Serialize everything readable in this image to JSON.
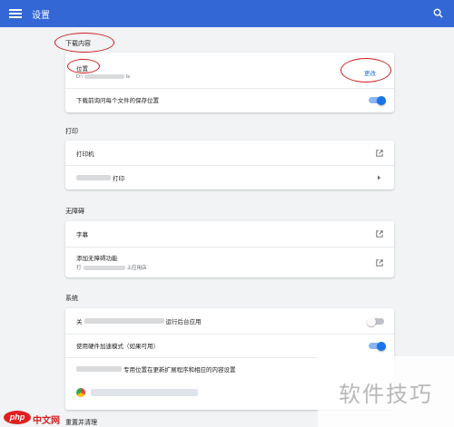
{
  "topbar": {
    "title": "设置"
  },
  "download": {
    "section_title": "下载内容",
    "location_label": "位置",
    "location_path": "D:\\",
    "location_suffix": "ls",
    "change_button": "更改",
    "ask_label": "下载前询问每个文件的保存位置",
    "ask_enabled": true
  },
  "print": {
    "section_title": "打印",
    "printers_label": "打印机",
    "cloud_print_label": "打印"
  },
  "accessibility": {
    "section_title": "无障碍",
    "captions_label": "字幕",
    "add_features_label": "添加无障碍功能",
    "add_features_sub_prefix": "打",
    "add_features_sub_suffix": "上应用店"
  },
  "system": {
    "section_title": "系统",
    "background_apps_prefix": "关",
    "background_apps_suffix": "运行后台应用",
    "background_apps_enabled": false,
    "hw_accel_label": "使用硬件加速模式（如果可用）",
    "hw_accel_enabled": true,
    "proxy_label": "专用位置在更新扩展程序和相应的内容设置"
  },
  "reset": {
    "section_title": "重置并清理"
  },
  "watermark": {
    "text": "软件技巧"
  },
  "logo": {
    "php": "php",
    "cn": "中文网"
  },
  "colors": {
    "accent": "#3367d6",
    "link": "#1a73e8",
    "annotation": "#cc1d1d"
  }
}
